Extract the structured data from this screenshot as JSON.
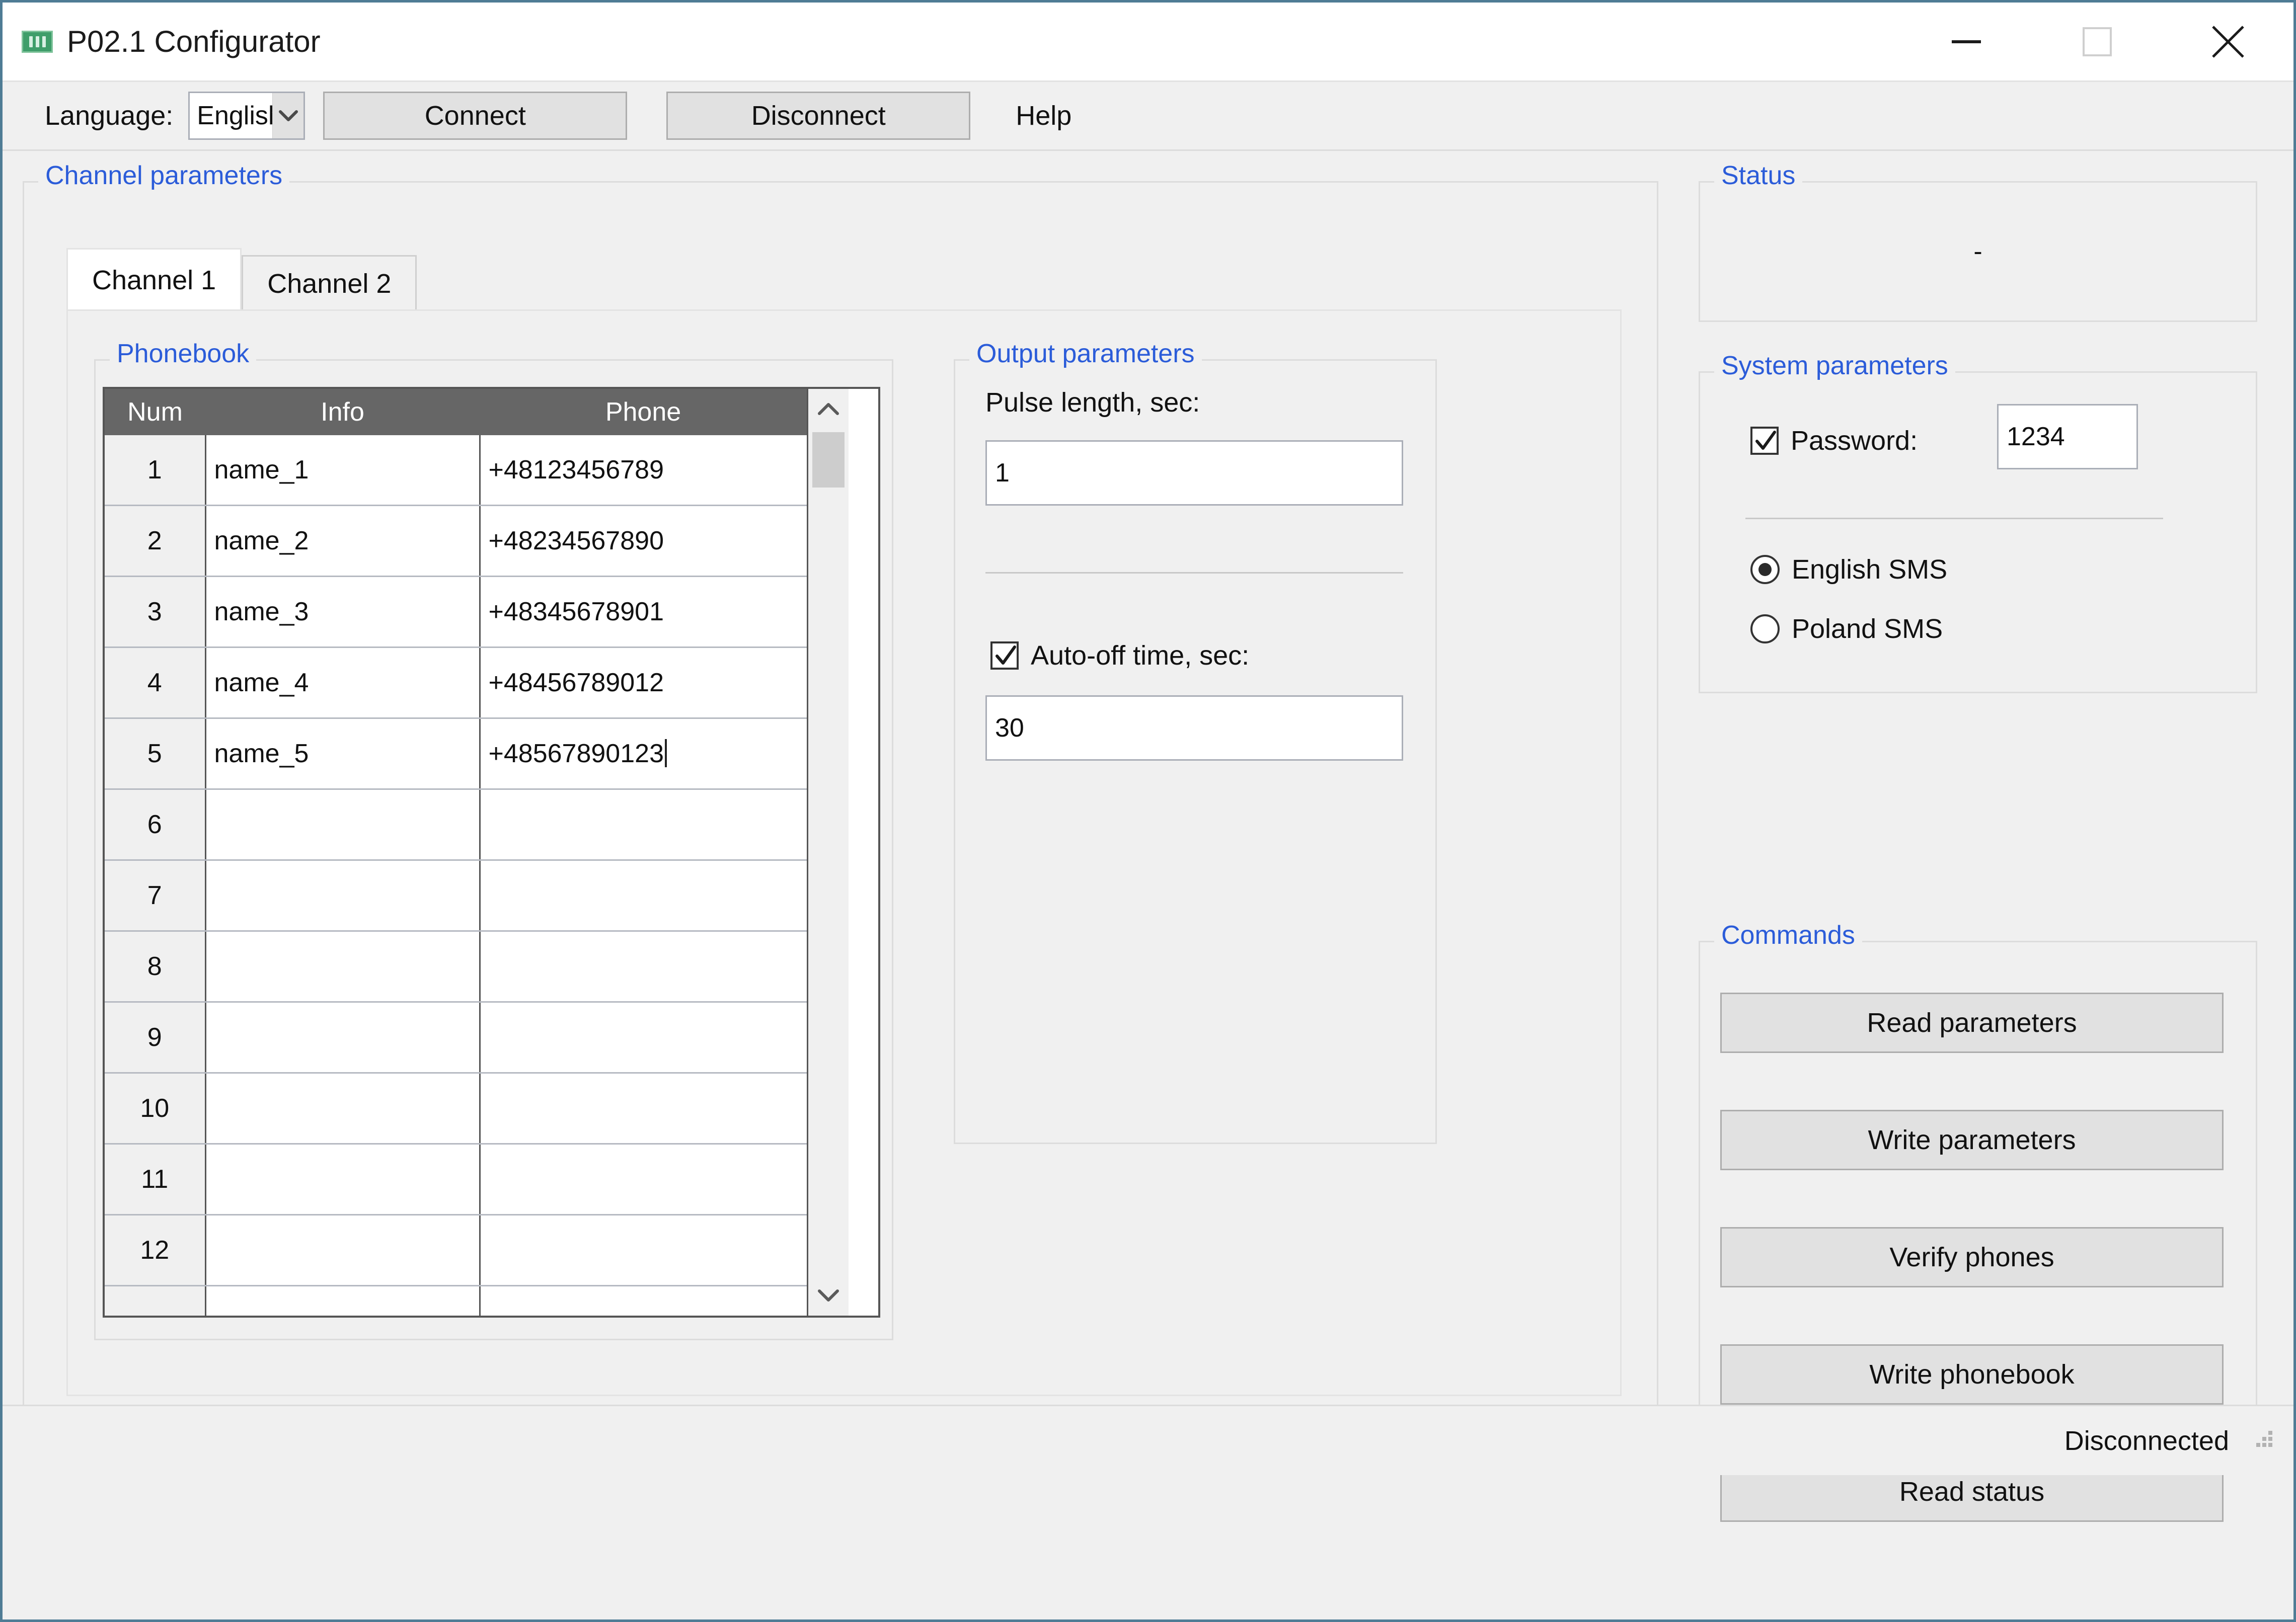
{
  "window": {
    "title": "P02.1 Configurator",
    "icon": "app-icon",
    "minimize_label": "—",
    "maximize_label": "□",
    "close_label": "✕"
  },
  "toolbar": {
    "language_label": "Language:",
    "language_value": "English",
    "language_options": [
      "English"
    ],
    "connect_label": "Connect",
    "disconnect_label": "Disconnect",
    "help_label": "Help"
  },
  "channel_parameters": {
    "legend": "Channel parameters",
    "tabs": [
      {
        "label": "Channel 1",
        "active": true
      },
      {
        "label": "Channel 2",
        "active": false
      }
    ]
  },
  "phonebook": {
    "legend": "Phonebook",
    "columns": [
      "Num",
      "Info",
      "Phone"
    ],
    "rows": [
      {
        "num": "1",
        "info": "name_1",
        "phone": "+48123456789"
      },
      {
        "num": "2",
        "info": "name_2",
        "phone": "+48234567890"
      },
      {
        "num": "3",
        "info": "name_3",
        "phone": "+48345678901"
      },
      {
        "num": "4",
        "info": "name_4",
        "phone": "+48456789012"
      },
      {
        "num": "5",
        "info": "name_5",
        "phone": "+48567890123",
        "caret": true
      },
      {
        "num": "6",
        "info": "",
        "phone": ""
      },
      {
        "num": "7",
        "info": "",
        "phone": ""
      },
      {
        "num": "8",
        "info": "",
        "phone": ""
      },
      {
        "num": "9",
        "info": "",
        "phone": ""
      },
      {
        "num": "10",
        "info": "",
        "phone": ""
      },
      {
        "num": "11",
        "info": "",
        "phone": ""
      },
      {
        "num": "12",
        "info": "",
        "phone": ""
      },
      {
        "num": "",
        "info": "",
        "phone": ""
      }
    ]
  },
  "output_parameters": {
    "legend": "Output parameters",
    "pulse_length_label": "Pulse length, sec:",
    "pulse_length_value": "1",
    "auto_off_label": "Auto-off time, sec:",
    "auto_off_checked": true,
    "auto_off_value": "30"
  },
  "status_panel": {
    "legend": "Status",
    "value": "-"
  },
  "system_parameters": {
    "legend": "System parameters",
    "password_label": "Password:",
    "password_checked": true,
    "password_value": "1234",
    "sms_options": [
      {
        "label": "English SMS",
        "selected": true
      },
      {
        "label": "Poland SMS",
        "selected": false
      }
    ]
  },
  "commands": {
    "legend": "Commands",
    "buttons": [
      "Read parameters",
      "Write parameters",
      "Verify phones",
      "Write phonebook",
      "Read status"
    ]
  },
  "statusbar": {
    "text": "Disconnected"
  },
  "colors": {
    "accent_blue": "#2b5cd9",
    "window_border": "#4f7c95",
    "table_header_bg": "#666666",
    "panel_bg": "#f0f0f0",
    "button_bg": "#e1e1e1"
  }
}
